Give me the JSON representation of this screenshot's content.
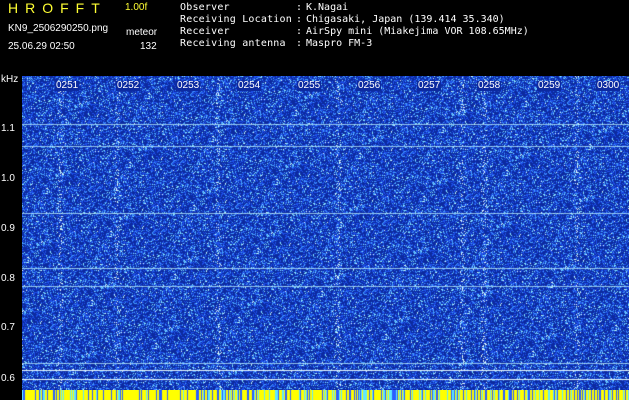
{
  "header": {
    "app_title": "HROFFT",
    "version": "1.00f",
    "filename": "KN9_2506290250.png",
    "mode": "meteor",
    "datetime": "25.06.29 02:50",
    "count": "132",
    "meta": [
      {
        "label": "Observer",
        "value": "K.Nagai"
      },
      {
        "label": "Receiving Location",
        "value": "Chigasaki, Japan (139.414 35.340)"
      },
      {
        "label": "Receiver",
        "value": "AirSpy mini (Miakejima VOR 108.65MHz)"
      },
      {
        "label": "Receiving antenna",
        "value": "Maspro FM-3"
      }
    ],
    "colon": ":"
  },
  "waterfall": {
    "y_unit": "kHz",
    "y_ticks": [
      "1.1",
      "1.0",
      "0.9",
      "0.8",
      "0.7",
      "0.6"
    ],
    "x_ticks": [
      "0251",
      "0252",
      "0253",
      "0254",
      "0255",
      "0256",
      "0257",
      "0258",
      "0259",
      "0300"
    ],
    "colors": {
      "background": "#0c2aa0",
      "noise_low": "#2a5cff",
      "noise_high": "#5fe8ff",
      "line": "#bff4ff",
      "strip": "#ffff00"
    }
  }
}
